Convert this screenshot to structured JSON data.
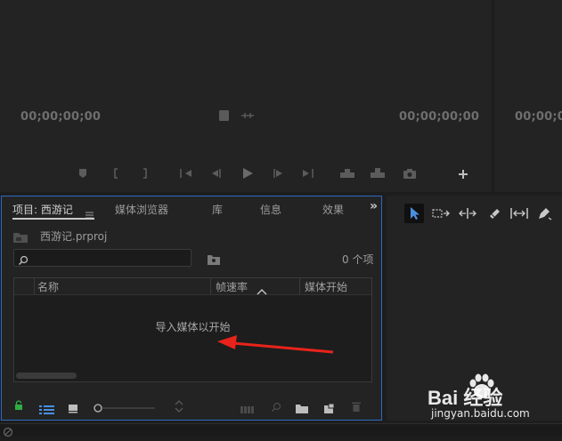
{
  "source_monitor": {
    "timecode_in": "00;00;00;00",
    "timecode_out": "00;00;00;00"
  },
  "program_monitor": {
    "timecode": "00;00;0"
  },
  "project_panel": {
    "tabs": [
      {
        "label": "项目: 西游记",
        "active": true
      },
      {
        "label": "媒体浏览器"
      },
      {
        "label": "库"
      },
      {
        "label": "信息"
      },
      {
        "label": "效果"
      }
    ],
    "overflow": "»",
    "file_name": "西游记.prproj",
    "search_value": "",
    "item_count": "0 个项",
    "columns": [
      "名称",
      "帧速率",
      "媒体开始"
    ],
    "empty_message": "导入媒体以开始"
  },
  "watermark": {
    "brand": "Bai 经验",
    "url": "jingyan.baidu.com"
  },
  "colors": {
    "panel_border_active": "#2e6ac4",
    "selection_tool": "#4a90e2",
    "lock_icon": "#2fae45",
    "list_view_icon": "#4a90e2",
    "annotation_arrow": "#e8231b"
  }
}
